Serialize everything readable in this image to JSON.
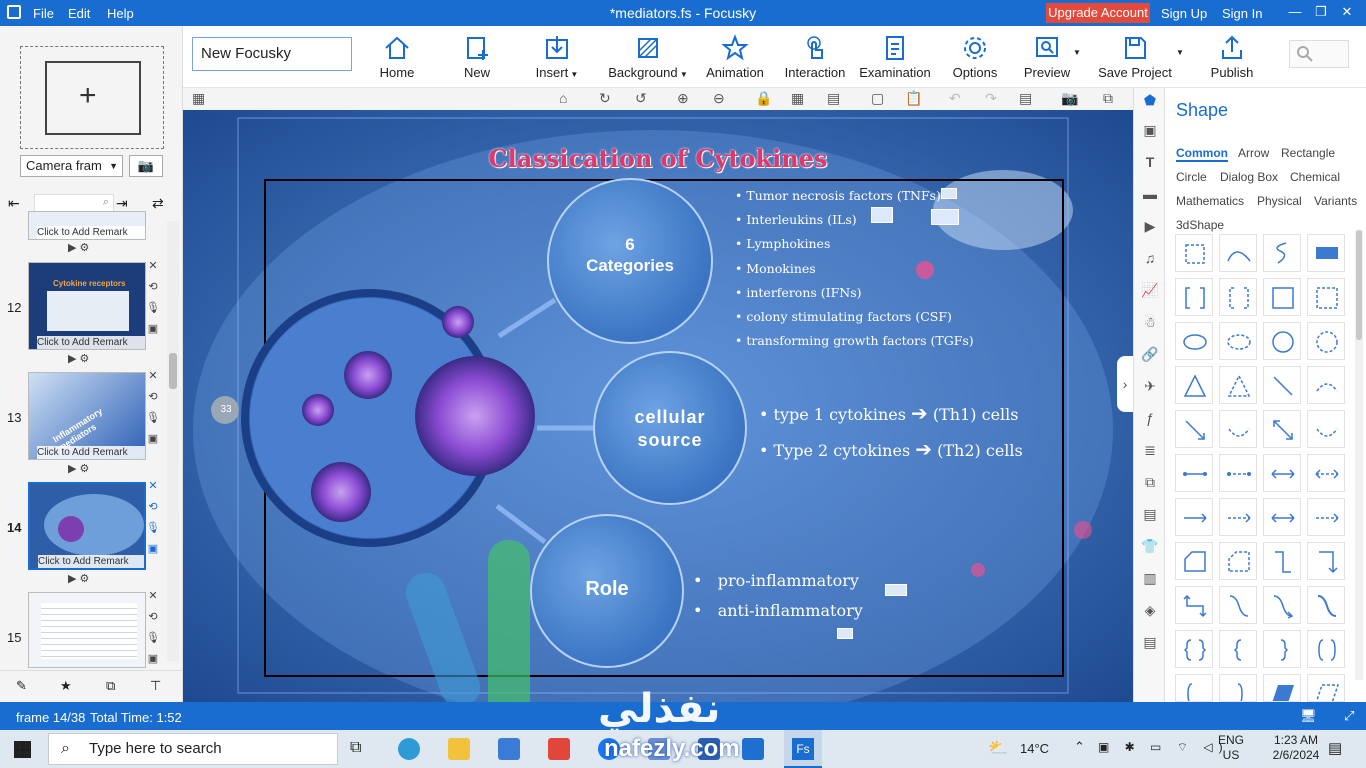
{
  "app": {
    "title": "*mediators.fs - Focusky",
    "menu": [
      "File",
      "Edit",
      "Help"
    ],
    "upgrade": "Upgrade Account",
    "signup": "Sign Up",
    "signin": "Sign In"
  },
  "toolbar": {
    "project_name": "New Focusky",
    "buttons": [
      "Home",
      "New",
      "Insert",
      "Background",
      "Animation",
      "Interaction",
      "Examination",
      "Options",
      "Preview",
      "Save Project",
      "Publish"
    ]
  },
  "left": {
    "camera_frame": "Camera fram",
    "thumb_caption": "Click to Add Remark",
    "frames": [
      {
        "num": "12",
        "title": "Cytokine receptors"
      },
      {
        "num": "13",
        "title": "Inflammatory mediators"
      },
      {
        "num": "14",
        "title": ""
      },
      {
        "num": "15",
        "title": ""
      }
    ]
  },
  "slide": {
    "title": "Classication of Cytokines",
    "bubble_categories": "6\nCategories",
    "bubble_cellular": "cellular\nsource",
    "bubble_role": "Role",
    "categories": [
      "Tumor necrosis factors (TNFs)",
      "Interleukins (ILs)",
      "Lymphokines",
      "Monokines",
      "interferons (IFNs)",
      "colony stimulating factors (CSF)",
      "transforming growth factors (TGFs)"
    ],
    "cellular": [
      {
        "left": "type 1 cytokines",
        "right": "(Th1) cells"
      },
      {
        "left": "Type 2 cytokines",
        "right": "(Th2) cells"
      }
    ],
    "roles": [
      "pro-inflammatory",
      "anti-inflammatory"
    ],
    "badge": "33"
  },
  "shape_panel": {
    "title": "Shape",
    "categories": [
      "Common",
      "Arrow",
      "Rectangle",
      "Circle",
      "Dialog Box",
      "Chemical",
      "Mathematics",
      "Physical",
      "Variants",
      "3dShape"
    ]
  },
  "status": {
    "frame": "frame 14/38",
    "total_time": "Total Time: 1:52"
  },
  "taskbar": {
    "search_placeholder": "Type here to search",
    "weather": "14°C",
    "lang1": "ENG",
    "lang2": "US",
    "time": "1:23 AM",
    "date": "2/6/2024",
    "watermark": "نفذلي",
    "watermark_url": "nafezly.com"
  },
  "colors": {
    "accent": "#1a6dd0",
    "upgrade": "#e24a3b",
    "title_red": "#e0386a"
  }
}
